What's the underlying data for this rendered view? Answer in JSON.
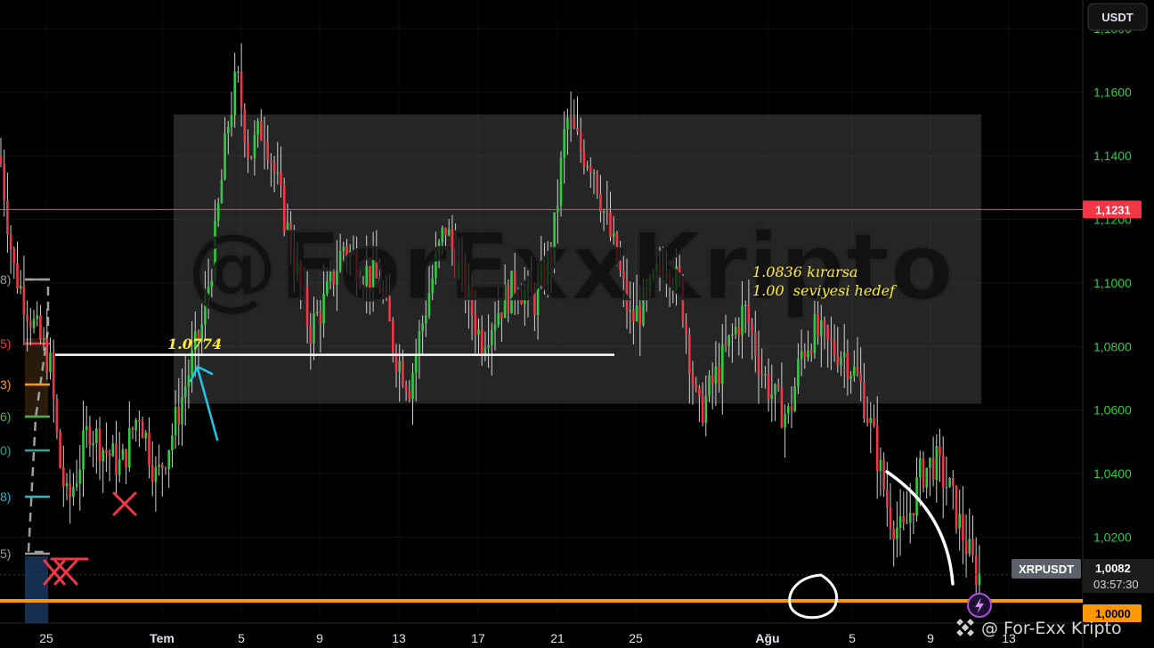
{
  "currency_button": "USDT",
  "watermark": "@ForExxKripto",
  "footer_brand": "@ For-Exx Kripto",
  "colors": {
    "up": "#2ecc40",
    "down": "#f23645",
    "bg": "#000000",
    "orange": "#ff9800",
    "resistance": "#ef5350"
  },
  "chart_data": {
    "type": "candlestick",
    "symbol": "XRPUSDT",
    "y_ticks": [
      "1,1800",
      "1,1600",
      "1,1400",
      "1,1200",
      "1,1000",
      "1,0800",
      "1,0600",
      "1,0400",
      "1,0200"
    ],
    "y_tick_values": [
      1.18,
      1.16,
      1.14,
      1.12,
      1.1,
      1.08,
      1.06,
      1.04,
      1.02
    ],
    "ylim": [
      0.993,
      1.189
    ],
    "x_ticks": [
      "25",
      "Tem",
      "5",
      "9",
      "13",
      "17",
      "21",
      "25",
      "Ağu",
      "5",
      "9",
      "13"
    ],
    "current_price": "1,0082",
    "current_price_value": 1.0082,
    "countdown": "03:57:30",
    "resistance_label": "1,1231",
    "resistance_value": 1.1231,
    "support_label": "1,0000",
    "support_value": 1.0,
    "level_line_value": 1.0774,
    "level_line_label": "1.0774",
    "annotation_lines": [
      "1.0836 kırarsa",
      "1.00  seviyesi hedef"
    ],
    "consolidation_box": {
      "high": 1.153,
      "low": 1.062
    },
    "fib_labels": [
      "8)",
      "5)",
      "3)",
      "6)",
      "0)",
      "8)",
      "5)"
    ],
    "fib_colors": [
      "#9e9e9e",
      "#f23645",
      "#ff9800",
      "#4caf50",
      "#26a69a",
      "#22b8cf",
      "#9e9e9e"
    ],
    "anchors": [
      [
        0,
        1.14
      ],
      [
        15,
        1.105
      ],
      [
        40,
        1.085
      ],
      [
        56,
        1.075
      ],
      [
        66,
        1.045
      ],
      [
        76,
        1.03
      ],
      [
        86,
        1.04
      ],
      [
        100,
        1.055
      ],
      [
        116,
        1.048
      ],
      [
        136,
        1.042
      ],
      [
        156,
        1.06
      ],
      [
        176,
        1.038
      ],
      [
        196,
        1.055
      ],
      [
        212,
        1.072
      ],
      [
        226,
        1.085
      ],
      [
        240,
        1.11
      ],
      [
        256,
        1.15
      ],
      [
        266,
        1.165
      ],
      [
        280,
        1.14
      ],
      [
        296,
        1.15
      ],
      [
        312,
        1.13
      ],
      [
        328,
        1.11
      ],
      [
        348,
        1.085
      ],
      [
        366,
        1.095
      ],
      [
        386,
        1.112
      ],
      [
        404,
        1.105
      ],
      [
        426,
        1.1
      ],
      [
        444,
        1.078
      ],
      [
        460,
        1.068
      ],
      [
        480,
        1.095
      ],
      [
        500,
        1.118
      ],
      [
        520,
        1.1
      ],
      [
        540,
        1.082
      ],
      [
        560,
        1.092
      ],
      [
        580,
        1.1
      ],
      [
        600,
        1.094
      ],
      [
        620,
        1.11
      ],
      [
        636,
        1.152
      ],
      [
        652,
        1.142
      ],
      [
        666,
        1.138
      ],
      [
        680,
        1.12
      ],
      [
        692,
        1.108
      ],
      [
        708,
        1.088
      ],
      [
        726,
        1.094
      ],
      [
        746,
        1.108
      ],
      [
        764,
        1.098
      ],
      [
        784,
        1.058
      ],
      [
        800,
        1.068
      ],
      [
        818,
        1.08
      ],
      [
        836,
        1.092
      ],
      [
        856,
        1.072
      ],
      [
        872,
        1.062
      ],
      [
        886,
        1.058
      ],
      [
        900,
        1.078
      ],
      [
        914,
        1.085
      ],
      [
        930,
        1.08
      ],
      [
        948,
        1.078
      ],
      [
        966,
        1.068
      ],
      [
        982,
        1.05
      ],
      [
        998,
        1.028
      ],
      [
        1014,
        1.02
      ],
      [
        1034,
        1.04
      ],
      [
        1050,
        1.044
      ],
      [
        1066,
        1.035
      ],
      [
        1080,
        1.022
      ],
      [
        1094,
        1.01
      ],
      [
        1100,
        1.008
      ]
    ]
  }
}
